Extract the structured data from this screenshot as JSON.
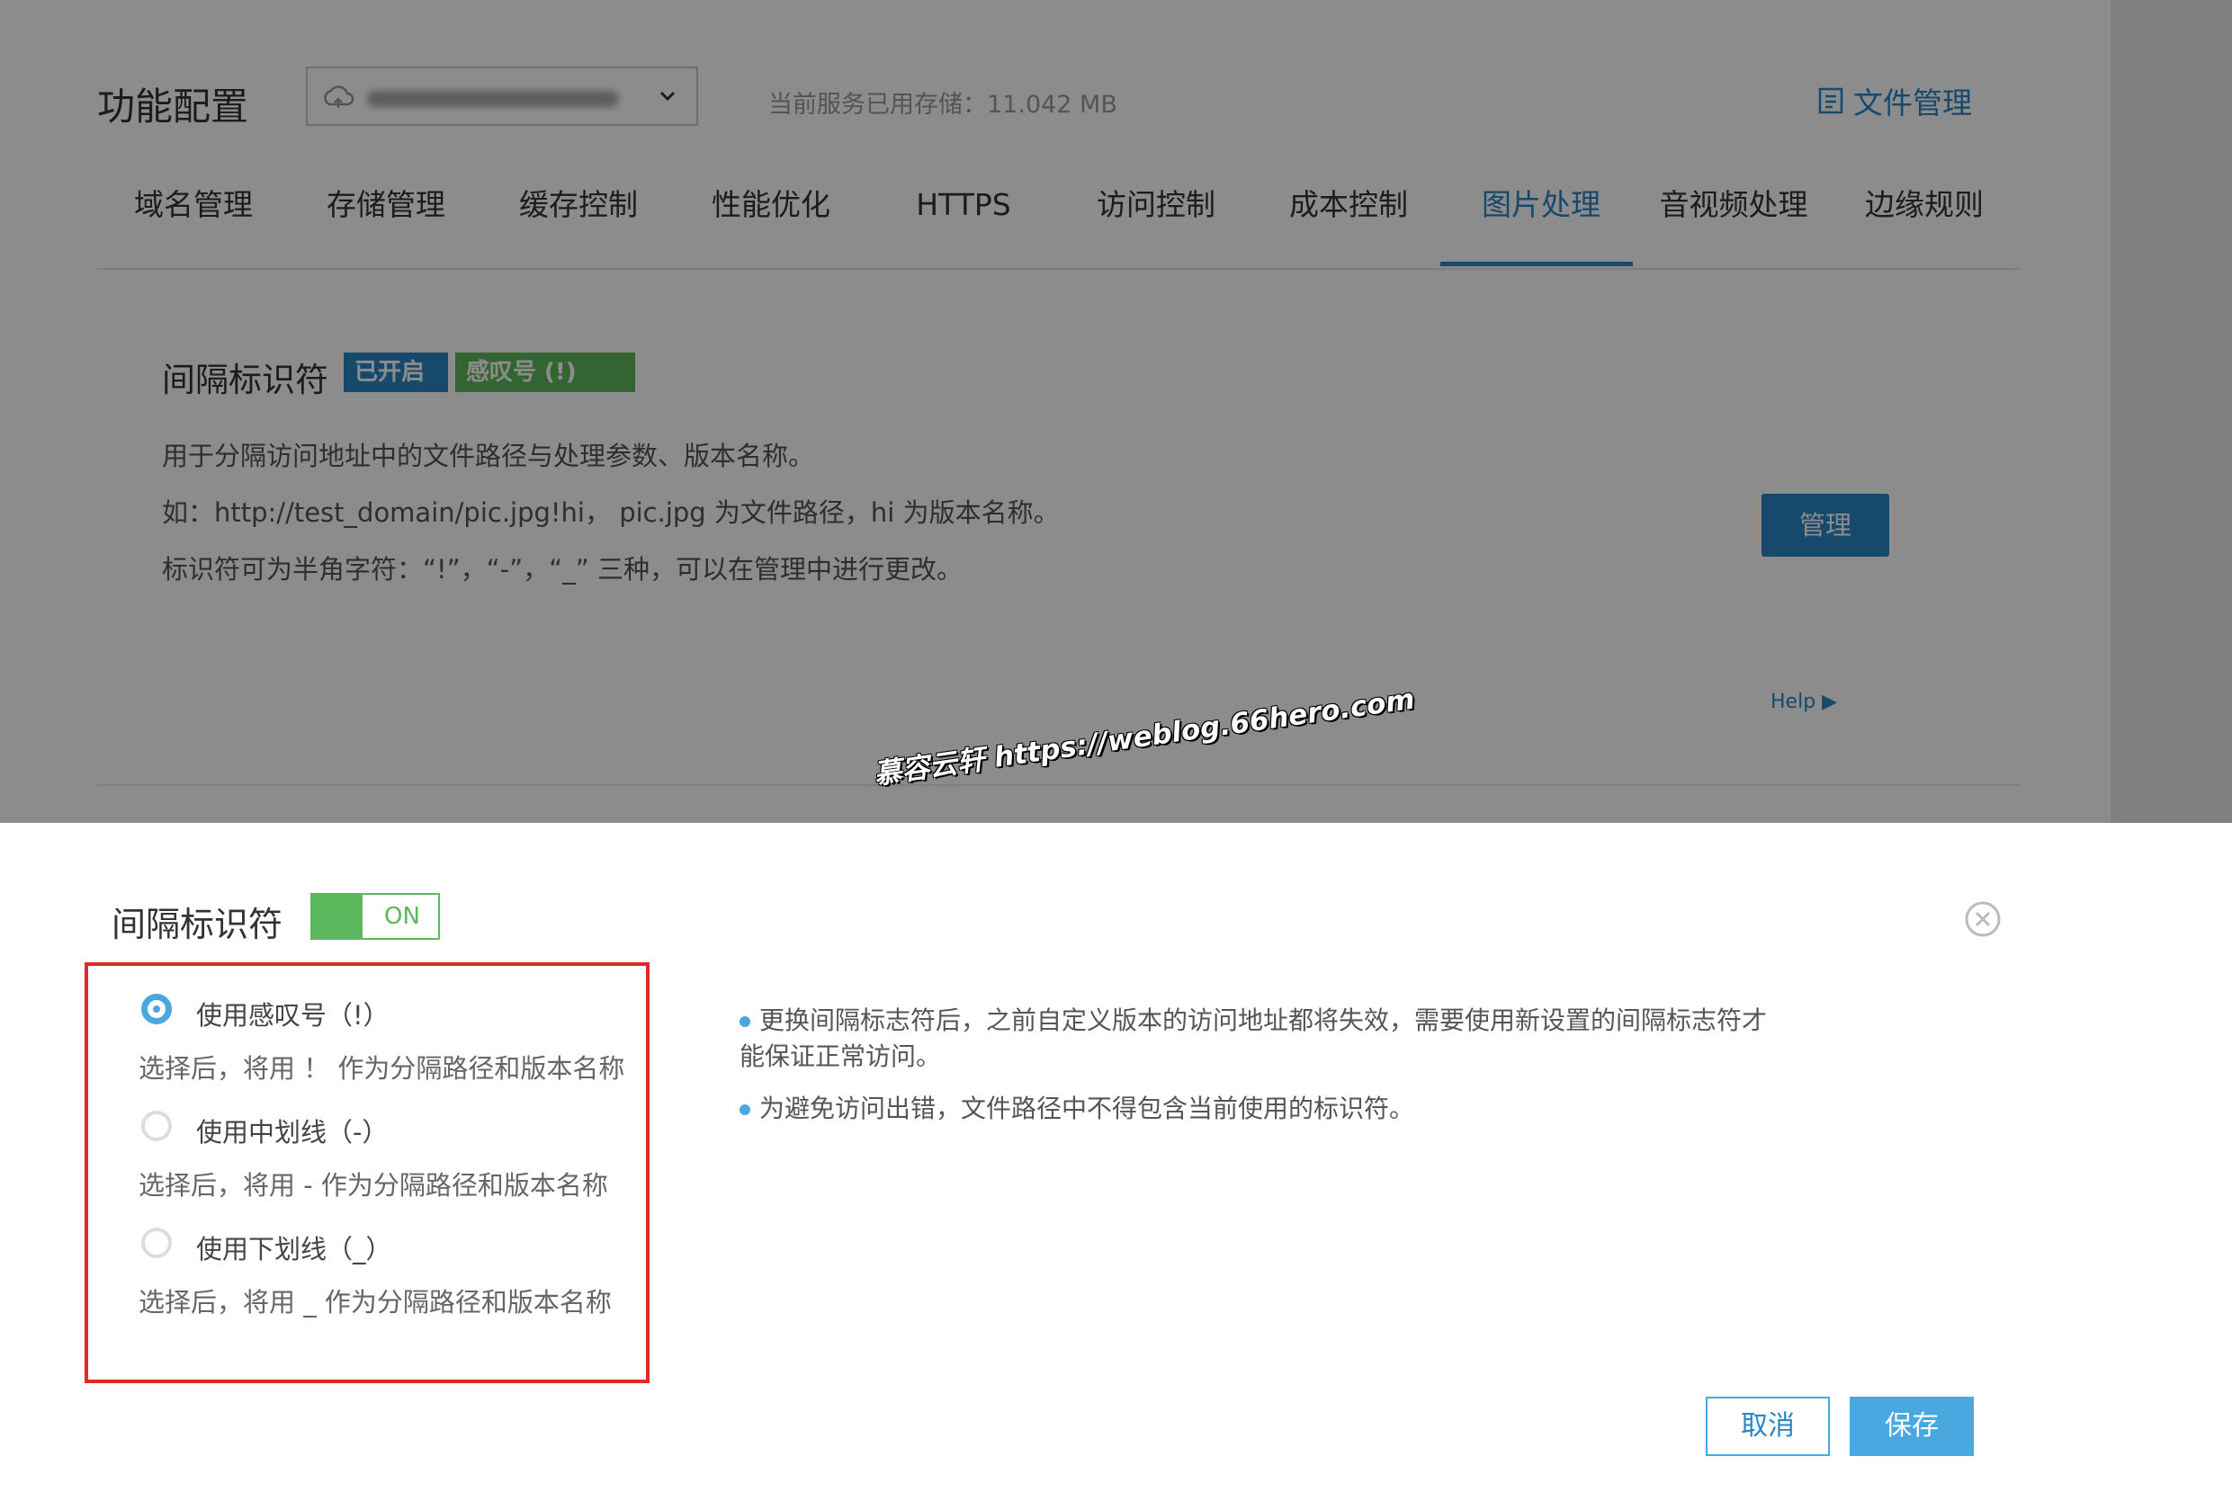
{
  "header": {
    "title": "功能配置",
    "storage_text": "当前服务已用存储：11.042 MB",
    "file_mgmt_label": "文件管理"
  },
  "tabs": [
    {
      "label": "域名管理"
    },
    {
      "label": "存储管理"
    },
    {
      "label": "缓存控制"
    },
    {
      "label": "性能优化"
    },
    {
      "label": "HTTPS"
    },
    {
      "label": "访问控制"
    },
    {
      "label": "成本控制"
    },
    {
      "label": "图片处理",
      "active": true
    },
    {
      "label": "音视频处理"
    },
    {
      "label": "边缘规则"
    }
  ],
  "section": {
    "title": "间隔标识符",
    "badge_status": "已开启",
    "badge_value": "感叹号 (!)",
    "desc1": "用于分隔访问地址中的文件路径与处理参数、版本名称。",
    "desc2": "如：http://test_domain/pic.jpg!hi， pic.jpg 为文件路径，hi 为版本名称。",
    "desc3": "标识符可为半角字符：“!”，“-”，“_” 三种，可以在管理中进行更改。",
    "manage_label": "管理",
    "help_label": "Help"
  },
  "watermark": "慕容云轩 https://weblog.66hero.com",
  "panel": {
    "title": "间隔标识符",
    "toggle_label": "ON",
    "options": [
      {
        "label": "使用感叹号（!）",
        "desc": "选择后，将用 ！ 作为分隔路径和版本名称",
        "selected": true
      },
      {
        "label": "使用中划线（-）",
        "desc": "选择后，将用 - 作为分隔路径和版本名称",
        "selected": false
      },
      {
        "label": "使用下划线（_）",
        "desc": "选择后，将用 _ 作为分隔路径和版本名称",
        "selected": false
      }
    ],
    "note1": "更换间隔标志符后，之前自定义版本的访问地址都将失效，需要使用新设置的间隔标志符才能保证正常访问。",
    "note2": "为避免访问出错，文件路径中不得包含当前使用的标识符。",
    "cancel_label": "取消",
    "save_label": "保存"
  },
  "colors": {
    "accent": "#2b86c5",
    "success": "#5cb85c",
    "highlight_border": "#e02a2a"
  }
}
